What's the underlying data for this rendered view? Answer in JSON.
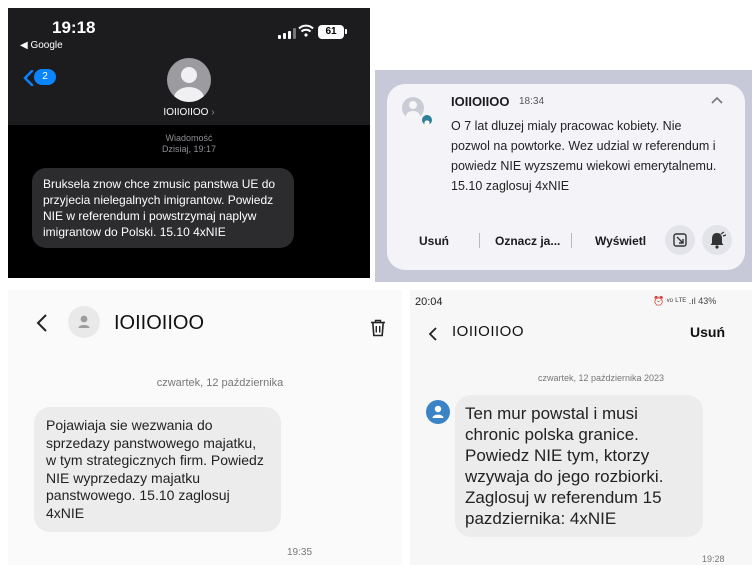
{
  "p1": {
    "time": "19:18",
    "back_app": "◀ Google",
    "battery": "61",
    "back_badge": "2",
    "contact": "IOIIOIIOO",
    "contact_chevron": "›",
    "msg_label": "Wiadomość",
    "msg_date": "Dzisiaj, 19:17",
    "message": "Bruksela znow chce zmusic panstwa UE do przyjecia nielegalnych imigrantow. Powiedz NIE w referendum i powstrzymaj naplyw imigrantow do Polski. 15.10 4xNIE"
  },
  "p2": {
    "sender": "IOIIOIIOO",
    "time": "18:34",
    "message": "O 7 lat dluzej mialy pracowac kobiety. Nie pozwol na powtorke. Wez udzial w referendum i powiedz NIE wyzszemu wiekowi emerytalnemu. 15.10 zaglosuj 4xNIE",
    "actions": {
      "reply": "Usuń",
      "mark": "Oznacz ja...",
      "show": "Wyświetl"
    }
  },
  "p3": {
    "contact": "IOIIOIIOO",
    "date": "czwartek, 12 października",
    "message": "Pojawiaja sie wezwania do sprzedazy panstwowego majatku, w tym strategicznych firm. Powiedz NIE wyprzedazy majatku panstwowego. 15.10 zaglosuj 4xNIE",
    "time": "19:35"
  },
  "p4": {
    "status_time": "20:04",
    "status_icons": "⏰ ᵛᵒ ᴸᵀᴱ .ıl 43%",
    "contact": "IOIIOIIOO",
    "delete": "Usuń",
    "date": "czwartek, 12 października 2023",
    "message": "Ten mur powstal i musi chronic polska granice. Powiedz NIE tym, ktorzy wzywaja do jego rozbiorki. Zaglosuj w referendum 15 pazdziernika: 4xNIE",
    "time": "19:28"
  },
  "icons": {
    "p1": [
      "signal-bars-icon",
      "wifi-icon",
      "battery-icon",
      "back-chevron-icon",
      "contact-avatar-icon"
    ],
    "p2": [
      "contact-avatar-icon",
      "collapse-chevron-icon",
      "snooze-icon",
      "bell-icon"
    ],
    "p3": [
      "back-arrow-icon",
      "contact-avatar-icon",
      "trash-icon"
    ],
    "p4": [
      "back-arrow-icon",
      "contact-avatar-icon"
    ]
  },
  "colors": {
    "ios_bg": "#000000",
    "ios_bubble": "#2c2c2e",
    "ios_accent": "#0a84ff",
    "notif_backdrop": "#c7c9d9",
    "android_bubble": "#ececec",
    "android_avatar": "#3a84c6"
  }
}
